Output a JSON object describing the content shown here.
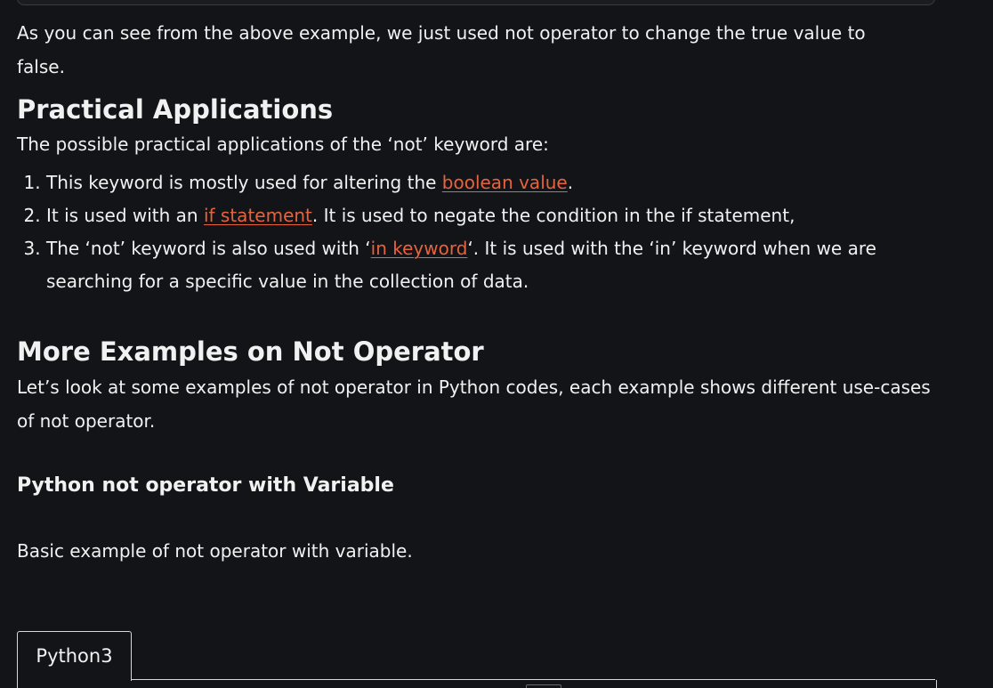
{
  "intro": {
    "text": "As you can see from the above example, we just used not operator to change the true value to false."
  },
  "practical": {
    "heading": "Practical Applications",
    "intro": "The possible practical applications of the ‘not’ keyword are:",
    "items": [
      {
        "before": "This keyword is mostly used for altering the ",
        "link": "boolean value",
        "after": "."
      },
      {
        "before": "It is used with an ",
        "link": "if statement",
        "after": ". It is used to negate the condition in the if statement,"
      },
      {
        "before": "The ‘not’ keyword is also used with ‘",
        "link": "in keyword",
        "after": "‘. It is used with the ‘in’ keyword when we are searching for a specific value in the collection of data."
      }
    ]
  },
  "more_examples": {
    "heading": "More Examples on Not Operator",
    "intro": "Let’s look at some examples of not operator in Python codes, each example shows different use-cases of not operator."
  },
  "variable_section": {
    "heading": "Python not operator with Variable",
    "intro": "Basic example of not operator with variable."
  },
  "code_block": {
    "tab_label": "Python3"
  },
  "colors": {
    "background": "#131417",
    "text": "#f1f1f1",
    "link": "#e8623d",
    "border": "#d8d8d8"
  }
}
